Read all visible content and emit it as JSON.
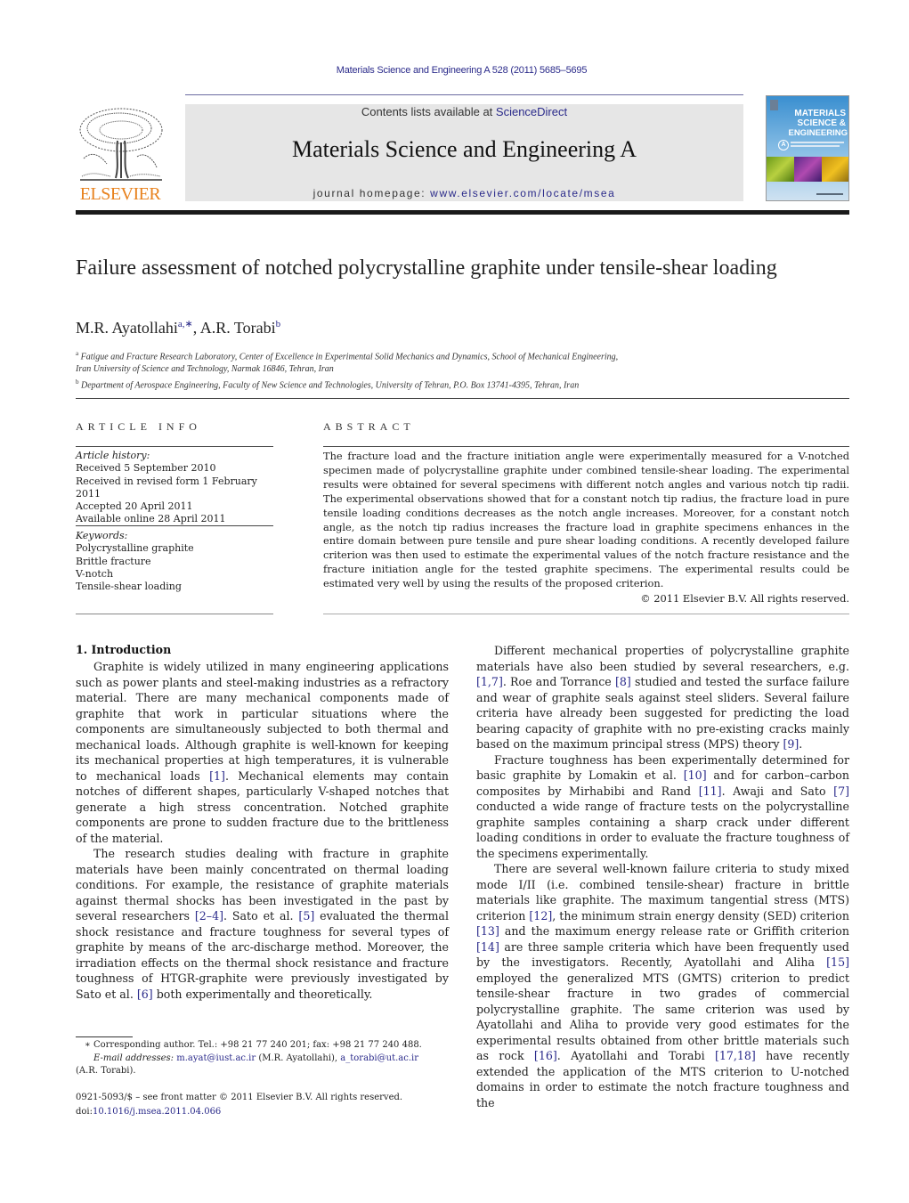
{
  "header": {
    "citation": "Materials Science and Engineering A 528 (2011) 5685–5695",
    "contents_prefix": "Contents lists available at ",
    "contents_link": "ScienceDirect",
    "journal_title": "Materials Science and Engineering A",
    "homepage_prefix": "journal homepage: ",
    "homepage_link": "www.elsevier.com/locate/msea",
    "publisher_logo_text": "ELSEVIER",
    "cover": {
      "line1": "MATERIALS",
      "line2": "SCIENCE &",
      "line3": "ENGINEERING",
      "badge": "A"
    }
  },
  "colors": {
    "link": "#2a2a8a",
    "elsevier_orange": "#e8821e",
    "journal_box_bg": "#e6e6e6"
  },
  "article": {
    "title": "Failure assessment of notched polycrystalline graphite under tensile-shear loading",
    "authors": [
      {
        "name": "M.R. Ayatollahi",
        "sup": "a,∗"
      },
      {
        "name": "A.R. Torabi",
        "sup": "b"
      }
    ],
    "author_separator": ", ",
    "affiliations": [
      {
        "sup": "a",
        "text": "Fatigue and Fracture Research Laboratory, Center of Excellence in Experimental Solid Mechanics and Dynamics, School of Mechanical Engineering,",
        "text2": "Iran University of Science and Technology, Narmak 16846, Tehran, Iran"
      },
      {
        "sup": "b",
        "text": "Department of Aerospace Engineering, Faculty of New Science and Technologies, University of Tehran, P.O. Box 13741-4395, Tehran, Iran"
      }
    ]
  },
  "article_info": {
    "label": "ARTICLE INFO",
    "history_heading": "Article history:",
    "history": [
      "Received 5 September 2010",
      "Received in revised form 1 February 2011",
      "Accepted 20 April 2011",
      "Available online 28 April 2011"
    ],
    "keywords_heading": "Keywords:",
    "keywords": [
      "Polycrystalline graphite",
      "Brittle fracture",
      "V-notch",
      "Tensile-shear loading"
    ]
  },
  "abstract": {
    "label": "ABSTRACT",
    "text": "The fracture load and the fracture initiation angle were experimentally measured for a V-notched specimen made of polycrystalline graphite under combined tensile-shear loading. The experimental results were obtained for several specimens with different notch angles and various notch tip radii. The experimental observations showed that for a constant notch tip radius, the fracture load in pure tensile loading conditions decreases as the notch angle increases. Moreover, for a constant notch angle, as the notch tip radius increases the fracture load in graphite specimens enhances in the entire domain between pure tensile and pure shear loading conditions. A recently developed failure criterion was then used to estimate the experimental values of the notch fracture resistance and the fracture initiation angle for the tested graphite specimens. The experimental results could be estimated very well by using the results of the proposed criterion.",
    "copyright": "© 2011 Elsevier B.V. All rights reserved."
  },
  "body": {
    "section_heading": "1.  Introduction",
    "left_paragraphs": [
      [
        {
          "t": "Graphite is widely utilized in many engineering applications such as power plants and steel-making industries as a refractory material. There are many mechanical components made of graphite that work in particular situations where the components are simultaneously subjected to both thermal and mechanical loads. Although graphite is well-known for keeping its mechanical properties at high temperatures, it is vulnerable to mechanical loads "
        },
        {
          "ref": "[1]"
        },
        {
          "t": ". Mechanical elements may contain notches of different shapes, particularly V-shaped notches that generate a high stress concentration. Notched graphite components are prone to sudden fracture due to the brittleness of the material."
        }
      ],
      [
        {
          "t": "The research studies dealing with fracture in graphite materials have been mainly concentrated on thermal loading conditions. For example, the resistance of graphite materials against thermal shocks has been investigated in the past by several researchers "
        },
        {
          "ref": "[2–4]"
        },
        {
          "t": ". Sato et al. "
        },
        {
          "ref": "[5]"
        },
        {
          "t": " evaluated the thermal shock resistance and fracture toughness for several types of graphite by means of the arc-discharge method. Moreover, the irradiation effects on the thermal shock resistance and fracture toughness of HTGR-graphite were previously investigated by Sato et al. "
        },
        {
          "ref": "[6]"
        },
        {
          "t": " both experimentally and theoretically."
        }
      ]
    ],
    "right_paragraphs": [
      [
        {
          "t": "Different mechanical properties of polycrystalline graphite materials have also been studied by several researchers, e.g. "
        },
        {
          "ref": "[1,7]"
        },
        {
          "t": ". Roe and Torrance "
        },
        {
          "ref": "[8]"
        },
        {
          "t": " studied and tested the surface failure and wear of graphite seals against steel sliders. Several failure criteria have already been suggested for predicting the load bearing capacity of graphite with no pre-existing cracks mainly based on the maximum principal stress (MPS) theory "
        },
        {
          "ref": "[9]"
        },
        {
          "t": "."
        }
      ],
      [
        {
          "t": "Fracture toughness has been experimentally determined for basic graphite by Lomakin et al. "
        },
        {
          "ref": "[10]"
        },
        {
          "t": " and for carbon–carbon composites by Mirhabibi and Rand "
        },
        {
          "ref": "[11]"
        },
        {
          "t": ". Awaji and Sato "
        },
        {
          "ref": "[7]"
        },
        {
          "t": " conducted a wide range of fracture tests on the polycrystalline graphite samples containing a sharp crack under different loading conditions in order to evaluate the fracture toughness of the specimens experimentally."
        }
      ],
      [
        {
          "t": "There are several well-known failure criteria to study mixed mode I/II (i.e. combined tensile-shear) fracture in brittle materials like graphite. The maximum tangential stress (MTS) criterion "
        },
        {
          "ref": "[12]"
        },
        {
          "t": ", the minimum strain energy density (SED) criterion "
        },
        {
          "ref": "[13]"
        },
        {
          "t": " and the maximum energy release rate or Griffith criterion "
        },
        {
          "ref": "[14]"
        },
        {
          "t": " are three sample criteria which have been frequently used by the investigators. Recently, Ayatollahi and Aliha "
        },
        {
          "ref": "[15]"
        },
        {
          "t": " employed the generalized MTS (GMTS) criterion to predict tensile-shear fracture in two grades of commercial polycrystalline graphite. The same criterion was used by Ayatollahi and Aliha to provide very good estimates for the experimental results obtained from other brittle materials such as rock "
        },
        {
          "ref": "[16]"
        },
        {
          "t": ". Ayatollahi and Torabi "
        },
        {
          "ref": "[17,18]"
        },
        {
          "t": " have recently extended the application of the MTS criterion to U-notched domains in order to estimate the notch fracture toughness and the"
        }
      ]
    ]
  },
  "footnotes": {
    "corresponding": "∗ Corresponding author. Tel.: +98 21 77 240 201; fax: +98 21 77 240 488.",
    "email_label": "E-mail addresses:",
    "email1": "m.ayat@iust.ac.ir",
    "email1_owner": " (M.R. Ayatollahi), ",
    "email2": "a_torabi@ut.ac.ir",
    "email2_owner": "(A.R. Torabi).",
    "front_matter": "0921-5093/$ – see front matter © 2011 Elsevier B.V. All rights reserved.",
    "doi_prefix": "doi:",
    "doi": "10.1016/j.msea.2011.04.066"
  }
}
